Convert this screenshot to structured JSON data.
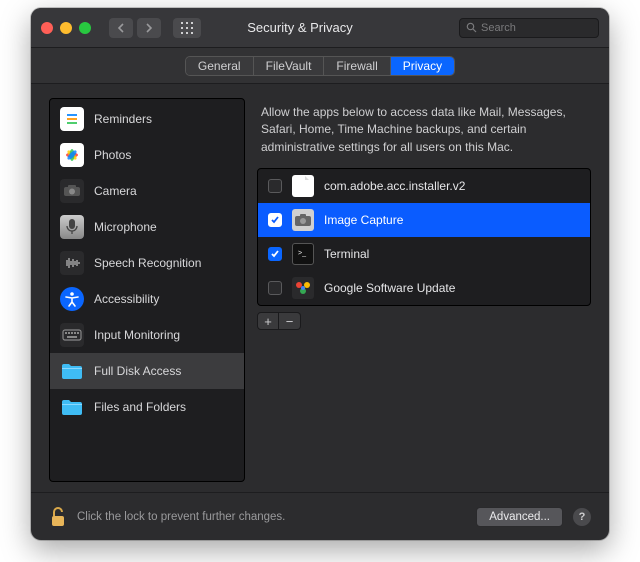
{
  "window": {
    "title": "Security & Privacy"
  },
  "search": {
    "placeholder": "Search"
  },
  "tabs": [
    {
      "label": "General",
      "active": false
    },
    {
      "label": "FileVault",
      "active": false
    },
    {
      "label": "Firewall",
      "active": false
    },
    {
      "label": "Privacy",
      "active": true
    }
  ],
  "sidebar": {
    "items": [
      {
        "label": "Reminders",
        "icon": "reminders"
      },
      {
        "label": "Photos",
        "icon": "photos"
      },
      {
        "label": "Camera",
        "icon": "camera"
      },
      {
        "label": "Microphone",
        "icon": "microphone"
      },
      {
        "label": "Speech Recognition",
        "icon": "speech"
      },
      {
        "label": "Accessibility",
        "icon": "accessibility"
      },
      {
        "label": "Input Monitoring",
        "icon": "input"
      },
      {
        "label": "Full Disk Access",
        "icon": "folder",
        "selected": true
      },
      {
        "label": "Files and Folders",
        "icon": "folder"
      }
    ]
  },
  "main": {
    "description": "Allow the apps below to access data like Mail, Messages, Safari, Home, Time Machine backups, and certain administrative settings for all users on this Mac.",
    "apps": [
      {
        "name": "com.adobe.acc.installer.v2",
        "checked": false,
        "icon": "document",
        "selected": false
      },
      {
        "name": "Image Capture",
        "checked": true,
        "icon": "image-capture",
        "selected": true
      },
      {
        "name": "Terminal",
        "checked": true,
        "icon": "terminal",
        "selected": false
      },
      {
        "name": "Google Software Update",
        "checked": false,
        "icon": "google-update",
        "selected": false
      }
    ]
  },
  "footer": {
    "lock_text": "Click the lock to prevent further changes.",
    "advanced_label": "Advanced...",
    "help_label": "?"
  },
  "buttons": {
    "plus": "+",
    "minus": "−"
  }
}
